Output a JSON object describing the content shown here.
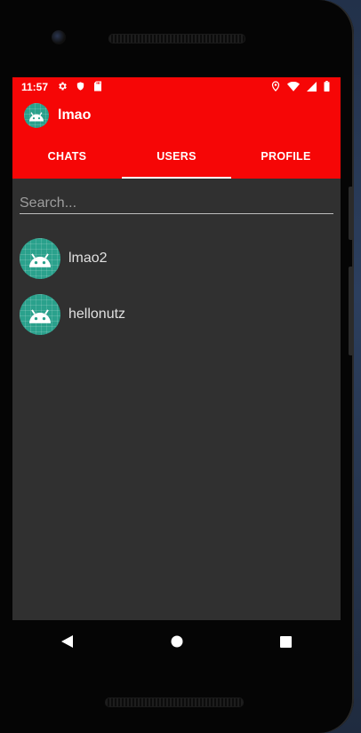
{
  "status_bar": {
    "time": "11:57",
    "left_icons": [
      "gear-icon",
      "shield-icon",
      "sd-card-icon"
    ],
    "right_icons": [
      "location-icon",
      "wifi-icon",
      "signal-icon",
      "battery-icon"
    ]
  },
  "app_bar": {
    "title": "lmao",
    "avatar_icon": "android-avatar-icon"
  },
  "tabs": [
    {
      "label": "CHATS",
      "active": false
    },
    {
      "label": "USERS",
      "active": true
    },
    {
      "label": "PROFILE",
      "active": false
    }
  ],
  "search": {
    "placeholder": "Search..."
  },
  "users": [
    {
      "name": "lmao2",
      "avatar_icon": "android-avatar-icon"
    },
    {
      "name": "hellonutz",
      "avatar_icon": "android-avatar-icon"
    }
  ],
  "nav_bar": {
    "icons": [
      "back-icon",
      "home-icon",
      "recents-icon"
    ]
  },
  "colors": {
    "primary": "#f60606",
    "background": "#303030",
    "avatar": "#2aa18c",
    "text": "#e0e0e0"
  }
}
